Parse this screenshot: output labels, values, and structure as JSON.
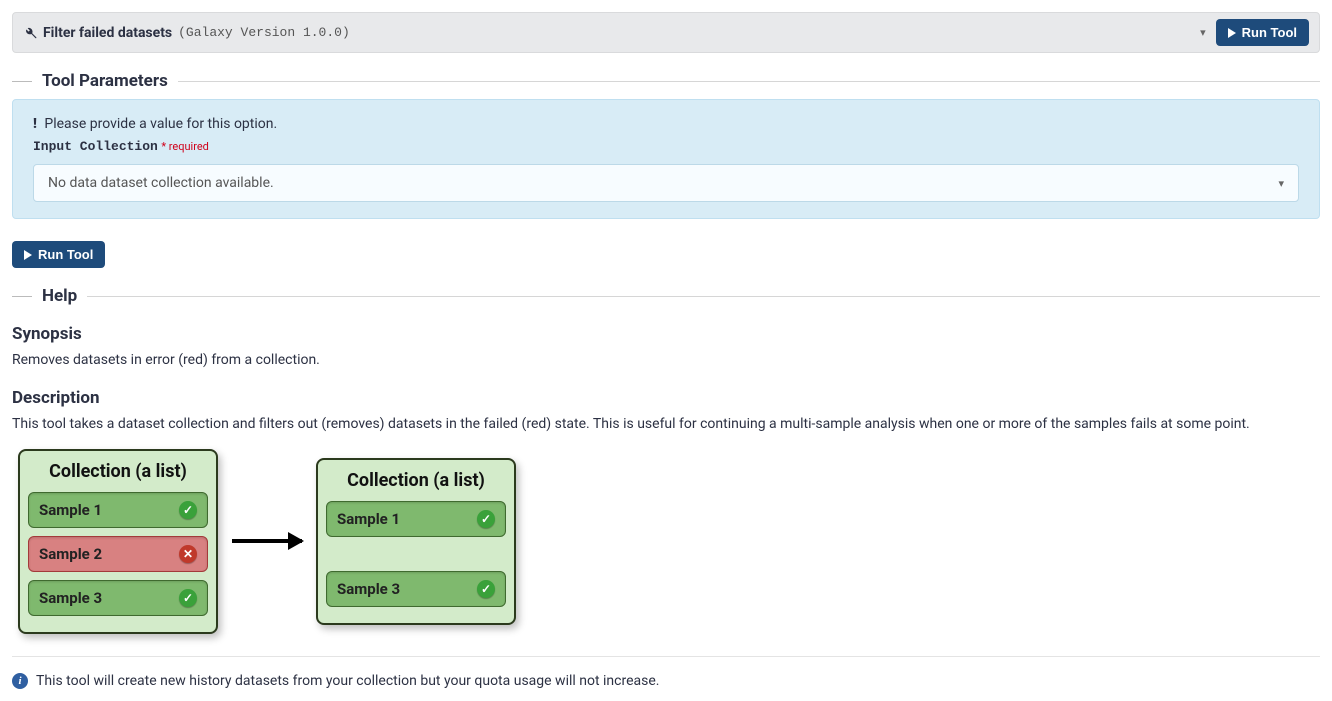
{
  "header": {
    "title": "Filter failed datasets",
    "version": "(Galaxy Version 1.0.0)",
    "run_label": "Run Tool"
  },
  "sections": {
    "parameters_title": "Tool Parameters",
    "help_title": "Help"
  },
  "param": {
    "warning": "Please provide a value for this option.",
    "label": "Input Collection",
    "required": "* required",
    "placeholder": "No data dataset collection available."
  },
  "run_button": "Run Tool",
  "help": {
    "synopsis_h": "Synopsis",
    "synopsis_p": "Removes datasets in error (red) from a collection.",
    "description_h": "Description",
    "description_p": "This tool takes a dataset collection and filters out (removes) datasets in the failed (red) state. This is useful for continuing a multi-sample analysis when one or more of the samples fails at some point."
  },
  "diagram": {
    "box_title": "Collection (a list)",
    "left_samples": [
      {
        "name": "Sample 1",
        "status": "ok"
      },
      {
        "name": "Sample 2",
        "status": "err"
      },
      {
        "name": "Sample 3",
        "status": "ok"
      }
    ],
    "right_samples": [
      {
        "name": "Sample 1",
        "status": "ok"
      },
      {
        "name": "",
        "status": "ghost"
      },
      {
        "name": "Sample 3",
        "status": "ok"
      }
    ]
  },
  "footer": {
    "note": "This tool will create new history datasets from your collection but your quota usage will not increase."
  }
}
